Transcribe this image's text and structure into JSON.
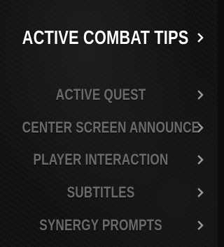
{
  "menu": {
    "active_item": {
      "label": "ACTIVE COMBAT TIPS",
      "chevron_icon": "chevron-right-icon"
    },
    "items": [
      {
        "label": "ACTIVE QUEST",
        "chevron_icon": "chevron-right-icon"
      },
      {
        "label": "CENTER SCREEN ANNOUNCE",
        "chevron_icon": "chevron-right-icon"
      },
      {
        "label": "PLAYER INTERACTION",
        "chevron_icon": "chevron-right-icon"
      },
      {
        "label": "SUBTITLES",
        "chevron_icon": "chevron-right-icon"
      },
      {
        "label": "SYNERGY PROMPTS",
        "chevron_icon": "chevron-right-icon"
      }
    ]
  },
  "colors": {
    "active_text": "#ffffff",
    "inactive_text": "#6a6a6a",
    "background": "#121212"
  }
}
